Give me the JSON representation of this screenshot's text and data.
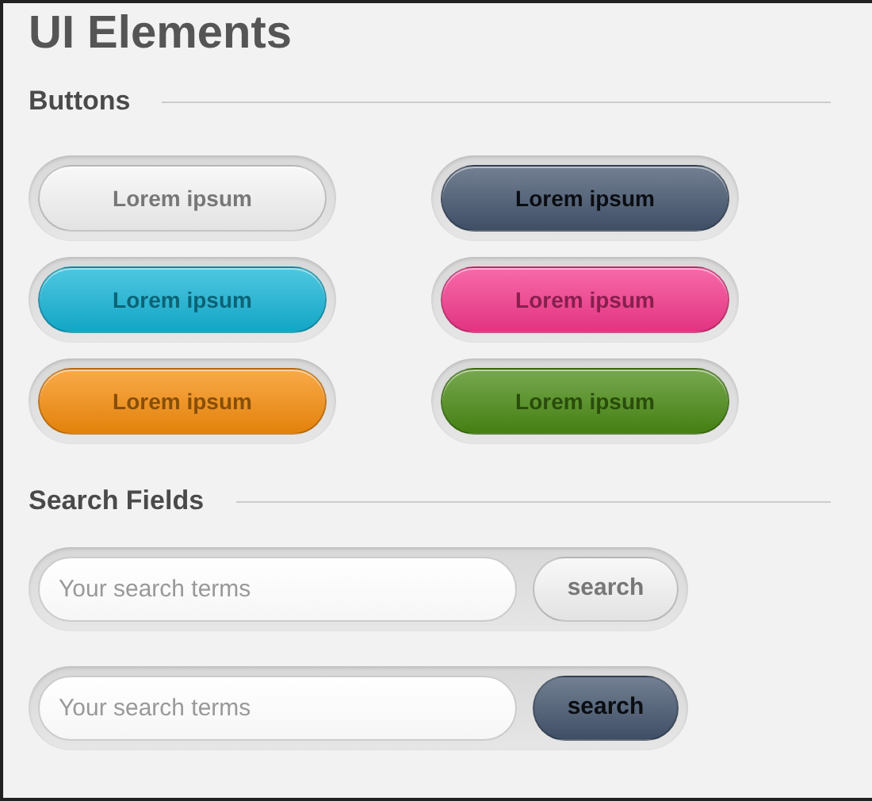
{
  "title": "UI Elements",
  "buttons_section": {
    "heading": "Buttons",
    "buttons": [
      {
        "label": "Lorem ipsum",
        "color": "#f6f6f6"
      },
      {
        "label": "Lorem ipsum",
        "color": "#44556e"
      },
      {
        "label": "Lorem ipsum",
        "color": "#14b4d6"
      },
      {
        "label": "Lorem ipsum",
        "color": "#f5388c"
      },
      {
        "label": "Lorem ipsum",
        "color": "#f68d0c"
      },
      {
        "label": "Lorem ipsum",
        "color": "#4a8a14"
      }
    ]
  },
  "search_section": {
    "heading": "Search Fields",
    "fields": [
      {
        "placeholder": "Your search terms",
        "button": "search",
        "color": "#f6f6f6"
      },
      {
        "placeholder": "Your search terms",
        "button": "search",
        "color": "#44556e"
      }
    ]
  }
}
